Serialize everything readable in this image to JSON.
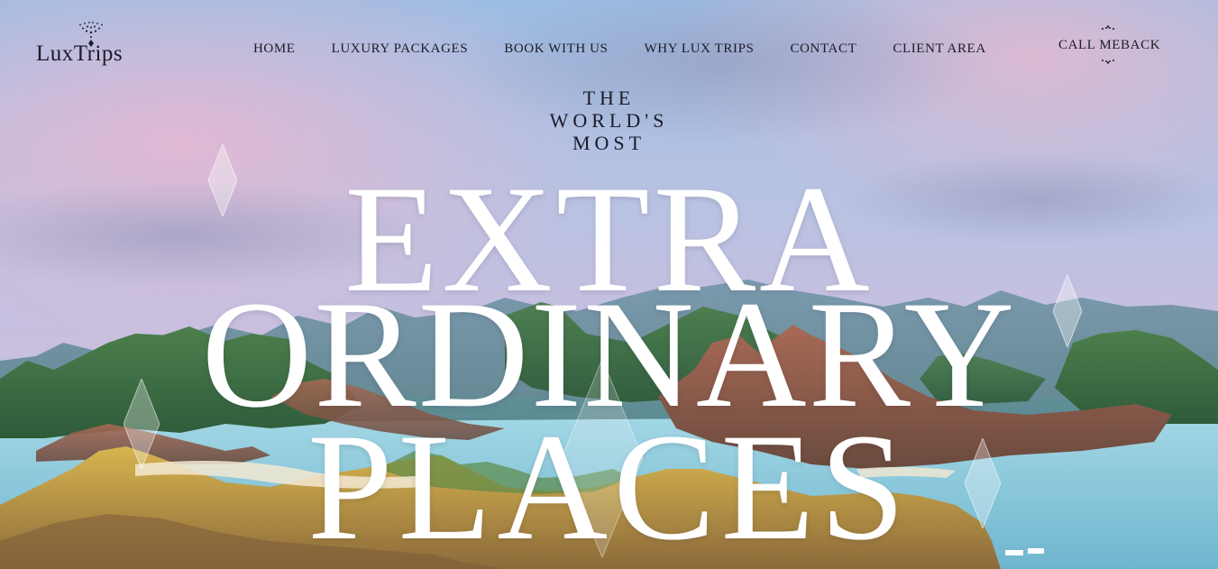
{
  "brand": {
    "name": "LuxTrips"
  },
  "nav": {
    "items": [
      {
        "label": "HOME"
      },
      {
        "label": "LUXURY PACKAGES"
      },
      {
        "label": "BOOK WITH US"
      },
      {
        "label": "WHY LUX TRIPS"
      },
      {
        "label": "CONTACT"
      },
      {
        "label": "CLIENT AREA"
      }
    ],
    "callback_label": "CALL MEBACK"
  },
  "hero": {
    "tagline": [
      "THE",
      "WORLD'S",
      "MOST"
    ],
    "headline": [
      "EXTRA",
      "ORDINARY",
      "PLACES"
    ]
  },
  "colors": {
    "text_dark": "#1c1b28",
    "headline": "#ffffff",
    "sky_top": "#8fb4dc",
    "sky_pink": "#d9b7d6",
    "water": "#9ed8e8",
    "hills_green": "#4c7f4c",
    "hills_gold": "#c9a646"
  },
  "icons": {
    "logo_mark": "sunburst-diamond-icon",
    "decor": "diamond-sparkle-icon"
  }
}
